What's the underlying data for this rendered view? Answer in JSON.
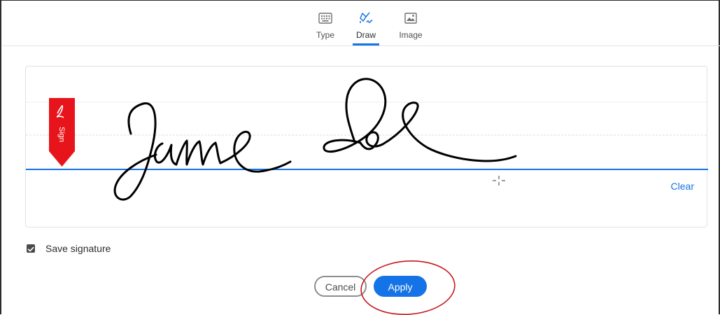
{
  "tabs": [
    {
      "label": "Type",
      "icon": "keyboard-icon"
    },
    {
      "label": "Draw",
      "icon": "pen-draw-icon",
      "active": true
    },
    {
      "label": "Image",
      "icon": "image-icon"
    }
  ],
  "signature": {
    "badge_text": "Sign",
    "clear_label": "Clear",
    "ink_color": "#000000",
    "baseline_color": "#1473e6",
    "badge_color": "#e8141b"
  },
  "save_signature": {
    "label": "Save signature",
    "checked": true
  },
  "buttons": {
    "cancel_label": "Cancel",
    "apply_label": "Apply"
  },
  "colors": {
    "accent": "#1473e6",
    "annotation": "#c8161d"
  }
}
